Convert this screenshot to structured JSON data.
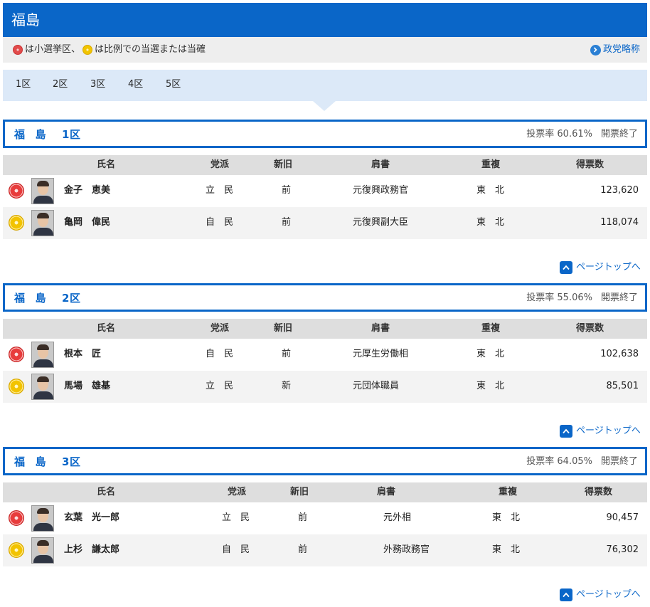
{
  "page": {
    "title": "福島",
    "legend_text": "は小選挙区、",
    "legend_text2": "は比例での当選または当確",
    "abbr_link": "政党略称",
    "page_top": "ページトップへ"
  },
  "colors": {
    "accent": "#0a66c8",
    "tab_bg": "#dce9f8",
    "single_seat": "#e24b4b",
    "proportional": "#f2c500"
  },
  "tabs": [
    "1区",
    "2区",
    "3区",
    "4区",
    "5区"
  ],
  "table_headers": [
    "氏名",
    "党派",
    "新旧",
    "肩書",
    "重複",
    "得票数"
  ],
  "districts": [
    {
      "name_a": "福",
      "name_b": "島",
      "name_c": "1区",
      "turnout": "投票率 60.61%",
      "status": "開票終了",
      "rows": [
        {
          "mark": "red",
          "name": "金子　恵美",
          "party": "立　民",
          "status": "前",
          "title": "元復興政務官",
          "dup": "東　北",
          "votes": "123,620"
        },
        {
          "mark": "yellow",
          "name": "亀岡　偉民",
          "party": "自　民",
          "status": "前",
          "title": "元復興副大臣",
          "dup": "東　北",
          "votes": "118,074"
        }
      ]
    },
    {
      "name_a": "福",
      "name_b": "島",
      "name_c": "2区",
      "turnout": "投票率 55.06%",
      "status": "開票終了",
      "rows": [
        {
          "mark": "red",
          "name": "根本　匠",
          "party": "自　民",
          "status": "前",
          "title": "元厚生労働相",
          "dup": "東　北",
          "votes": "102,638"
        },
        {
          "mark": "yellow",
          "name": "馬場　雄基",
          "party": "立　民",
          "status": "新",
          "title": "元団体職員",
          "dup": "東　北",
          "votes": "85,501"
        }
      ]
    },
    {
      "name_a": "福",
      "name_b": "島",
      "name_c": "3区",
      "turnout": "投票率 64.05%",
      "status": "開票終了",
      "rows": [
        {
          "mark": "red",
          "name": "玄葉　光一郎",
          "party": "立　民",
          "status": "前",
          "title": "元外相",
          "dup": "東　北",
          "votes": "90,457"
        },
        {
          "mark": "yellow",
          "name": "上杉　謙太郎",
          "party": "自　民",
          "status": "前",
          "title": "外務政務官",
          "dup": "東　北",
          "votes": "76,302"
        }
      ]
    }
  ]
}
